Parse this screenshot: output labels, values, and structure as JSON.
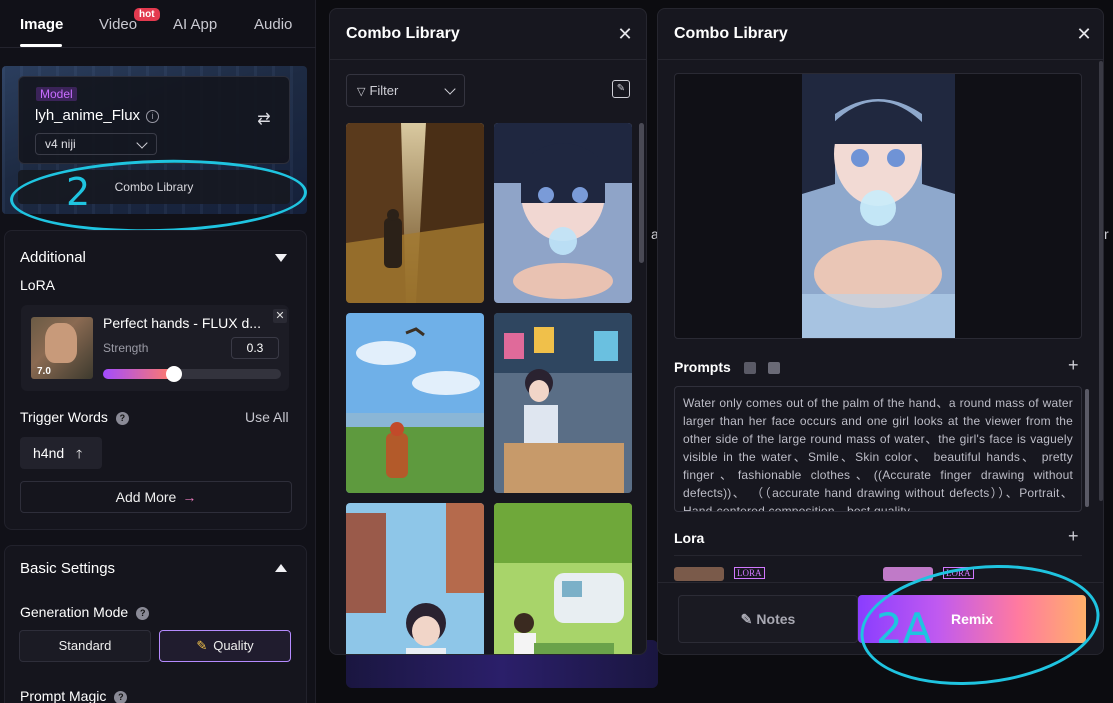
{
  "sidebar": {
    "tabs": [
      {
        "label": "Image",
        "active": true
      },
      {
        "label": "Video",
        "badge": "hot"
      },
      {
        "label": "AI App"
      },
      {
        "label": "Audio"
      }
    ],
    "model": {
      "tag": "Model",
      "name": "lyh_anime_Flux",
      "version": "v4 niji",
      "combo_library_label": "Combo Library"
    },
    "additional": {
      "title": "Additional",
      "lora_label": "LoRA",
      "lora": {
        "name": "Perfect hands - FLUX d...",
        "strength_label": "Strength",
        "strength_value": "0.3",
        "strength_fraction": 0.3,
        "version": "7.0"
      },
      "trigger_words_label": "Trigger Words",
      "use_all_label": "Use All",
      "trigger_word": "h4nd",
      "add_more_label": "Add More"
    },
    "basic": {
      "title": "Basic Settings",
      "generation_mode_label": "Generation Mode",
      "standard_label": "Standard",
      "quality_label": "Quality",
      "prompt_magic_label": "Prompt Magic"
    }
  },
  "combo_grid": {
    "title": "Combo Library",
    "filter_label": "Filter"
  },
  "combo_detail": {
    "title": "Combo Library",
    "prompts_label": "Prompts",
    "prompt_text": "Water only comes out of the palm of the hand、a round mass of water larger than her face occurs and one girl looks at the viewer from the other side of the large round mass of water、the girl's face is vaguely visible in the water、Smile、Skin color、 beautiful hands、 pretty finger、fashionable clothes、((Accurate finger drawing without defects))、 （（accurate hand drawing without defects））、Portrait、Hand-centered composition、best quality",
    "lora_label": "Lora",
    "lora_tag": "LORA",
    "notes_label": "Notes",
    "remix_label": "Remix"
  },
  "annotations": {
    "mark_1": "2",
    "mark_2": "2A"
  },
  "colors": {
    "accent_cyan": "#1fc4e0",
    "remix_gradient": [
      "#8a3dff",
      "#c05af0",
      "#ff7aa0",
      "#ffb06a"
    ],
    "badge_red": "#e33a4f"
  }
}
